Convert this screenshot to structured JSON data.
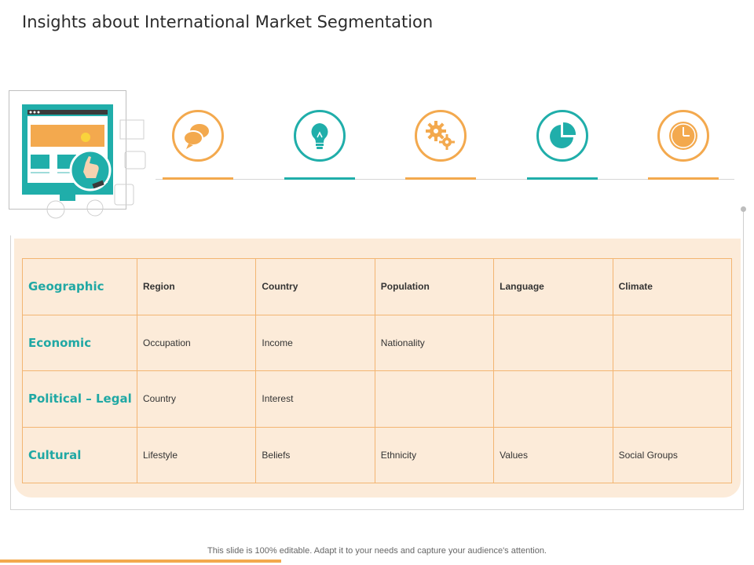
{
  "title": "Insights about International Market Segmentation",
  "colors": {
    "orange": "#f3a94e",
    "teal": "#20aeaa",
    "panel": "#fcebd9"
  },
  "icons": [
    {
      "name": "speech-bubbles-icon",
      "color": "orange"
    },
    {
      "name": "lightbulb-icon",
      "color": "teal"
    },
    {
      "name": "gears-icon",
      "color": "orange"
    },
    {
      "name": "pie-chart-icon",
      "color": "teal"
    },
    {
      "name": "clock-icon",
      "color": "orange"
    }
  ],
  "table": {
    "rows": [
      {
        "label": "Geographic",
        "cells": [
          "Region",
          "Country",
          "Population",
          "Language",
          "Climate"
        ]
      },
      {
        "label": "Economic",
        "cells": [
          "Occupation",
          "Income",
          "Nationality",
          "",
          ""
        ]
      },
      {
        "label": "Political – Legal",
        "cells": [
          "Country",
          "Interest",
          "",
          "",
          ""
        ]
      },
      {
        "label": "Cultural",
        "cells": [
          "Lifestyle",
          "Beliefs",
          "Ethnicity",
          "Values",
          "Social Groups"
        ]
      }
    ]
  },
  "footer": "This slide is 100% editable. Adapt it to your needs and capture your audience's attention."
}
